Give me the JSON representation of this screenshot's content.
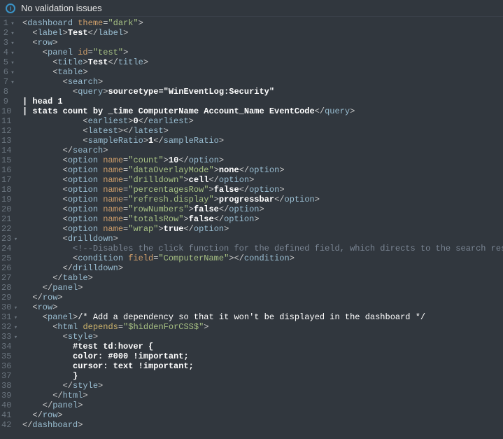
{
  "header": {
    "icon_label": "i",
    "title": "No validation issues"
  },
  "gutter": {
    "line_count": 42,
    "fold_lines": [
      1,
      2,
      3,
      4,
      5,
      6,
      7,
      23,
      30,
      31,
      32,
      33
    ]
  },
  "code": {
    "l1": {
      "pre": "<",
      "tag": "dashboard",
      "sp": " ",
      "attr": "theme",
      "eq": "=",
      "q1": "\"",
      "val": "dark",
      "q2": "\"",
      "suf": ">"
    },
    "l2": {
      "pre": "  <",
      "tag": "label",
      "suf": ">",
      "text": "Test",
      "cpre": "</",
      "ctag": "label",
      "csuf": ">"
    },
    "l3": {
      "pre": "  <",
      "tag": "row",
      "suf": ">"
    },
    "l4": {
      "pre": "    <",
      "tag": "panel",
      "sp": " ",
      "attr": "id",
      "eq": "=",
      "q1": "\"",
      "val": "test",
      "q2": "\"",
      "suf": ">"
    },
    "l5": {
      "pre": "      <",
      "tag": "title",
      "suf": ">",
      "text": "Test",
      "cpre": "</",
      "ctag": "title",
      "csuf": ">"
    },
    "l6": {
      "pre": "      <",
      "tag": "table",
      "suf": ">"
    },
    "l7": {
      "pre": "        <",
      "tag": "search",
      "suf": ">"
    },
    "l8": {
      "pre": "          <",
      "tag": "query",
      "suf": ">",
      "text": "sourcetype=\"WinEventLog:Security\""
    },
    "l9": {
      "text": "| head 1"
    },
    "l10": {
      "text": "| stats count by _time ComputerName Account_Name EventCode",
      "cpre": "</",
      "ctag": "query",
      "csuf": ">"
    },
    "l11": {
      "pre": "            <",
      "tag": "earliest",
      "suf": ">",
      "text": "0",
      "cpre": "</",
      "ctag": "earliest",
      "csuf": ">"
    },
    "l12": {
      "pre": "            <",
      "tag": "latest",
      "suf": ">",
      "cpre": "</",
      "ctag": "latest",
      "csuf": ">"
    },
    "l13": {
      "pre": "            <",
      "tag": "sampleRatio",
      "suf": ">",
      "text": "1",
      "cpre": "</",
      "ctag": "sampleRatio",
      "csuf": ">"
    },
    "l14": {
      "pre": "        </",
      "tag": "search",
      "suf": ">"
    },
    "l15": {
      "pre": "        <",
      "tag": "option",
      "sp": " ",
      "attr": "name",
      "eq": "=",
      "q1": "\"",
      "val": "count",
      "q2": "\"",
      "suf": ">",
      "text": "10",
      "cpre": "</",
      "ctag": "option",
      "csuf": ">"
    },
    "l16": {
      "pre": "        <",
      "tag": "option",
      "sp": " ",
      "attr": "name",
      "eq": "=",
      "q1": "\"",
      "val": "dataOverlayMode",
      "q2": "\"",
      "suf": ">",
      "text": "none",
      "cpre": "</",
      "ctag": "option",
      "csuf": ">"
    },
    "l17": {
      "pre": "        <",
      "tag": "option",
      "sp": " ",
      "attr": "name",
      "eq": "=",
      "q1": "\"",
      "val": "drilldown",
      "q2": "\"",
      "suf": ">",
      "text": "cell",
      "cpre": "</",
      "ctag": "option",
      "csuf": ">"
    },
    "l18": {
      "pre": "        <",
      "tag": "option",
      "sp": " ",
      "attr": "name",
      "eq": "=",
      "q1": "\"",
      "val": "percentagesRow",
      "q2": "\"",
      "suf": ">",
      "text": "false",
      "cpre": "</",
      "ctag": "option",
      "csuf": ">"
    },
    "l19": {
      "pre": "        <",
      "tag": "option",
      "sp": " ",
      "attr": "name",
      "eq": "=",
      "q1": "\"",
      "val": "refresh.display",
      "q2": "\"",
      "suf": ">",
      "text": "progressbar",
      "cpre": "</",
      "ctag": "option",
      "csuf": ">"
    },
    "l20": {
      "pre": "        <",
      "tag": "option",
      "sp": " ",
      "attr": "name",
      "eq": "=",
      "q1": "\"",
      "val": "rowNumbers",
      "q2": "\"",
      "suf": ">",
      "text": "false",
      "cpre": "</",
      "ctag": "option",
      "csuf": ">"
    },
    "l21": {
      "pre": "        <",
      "tag": "option",
      "sp": " ",
      "attr": "name",
      "eq": "=",
      "q1": "\"",
      "val": "totalsRow",
      "q2": "\"",
      "suf": ">",
      "text": "false",
      "cpre": "</",
      "ctag": "option",
      "csuf": ">"
    },
    "l22": {
      "pre": "        <",
      "tag": "option",
      "sp": " ",
      "attr": "name",
      "eq": "=",
      "q1": "\"",
      "val": "wrap",
      "q2": "\"",
      "suf": ">",
      "text": "true",
      "cpre": "</",
      "ctag": "option",
      "csuf": ">"
    },
    "l23": {
      "pre": "        <",
      "tag": "drilldown",
      "suf": ">"
    },
    "l24": {
      "comment": "          <!--Disables the click function for the defined field, which directs to the search results-->"
    },
    "l25": {
      "pre": "          <",
      "tag": "condition",
      "sp": " ",
      "attr": "field",
      "eq": "=",
      "q1": "\"",
      "val": "ComputerName",
      "q2": "\"",
      "suf": ">",
      "cpre": "</",
      "ctag": "condition",
      "csuf": ">"
    },
    "l26": {
      "pre": "        </",
      "tag": "drilldown",
      "suf": ">"
    },
    "l27": {
      "pre": "      </",
      "tag": "table",
      "suf": ">"
    },
    "l28": {
      "pre": "    </",
      "tag": "panel",
      "suf": ">"
    },
    "l29": {
      "pre": "  </",
      "tag": "row",
      "suf": ">"
    },
    "l30": {
      "pre": "  <",
      "tag": "row",
      "suf": ">"
    },
    "l31": {
      "pre": "    <",
      "tag": "panel",
      "suf": ">",
      "cmt": "/* Add a dependency so that it won't be displayed in the dashboard */"
    },
    "l32": {
      "pre": "      <",
      "tag": "html",
      "sp": " ",
      "attr": "depends",
      "eq": "=",
      "q1": "\"",
      "val": "$hiddenForCSS$",
      "q2": "\"",
      "suf": ">"
    },
    "l33": {
      "pre": "        <",
      "tag": "style",
      "suf": ">"
    },
    "l34": {
      "css": "          #test td:hover {"
    },
    "l35": {
      "css": "          color: #000 !important;"
    },
    "l36": {
      "css": "          cursor: text !important;"
    },
    "l37": {
      "css": "          }"
    },
    "l38": {
      "pre": "        </",
      "tag": "style",
      "suf": ">"
    },
    "l39": {
      "pre": "      </",
      "tag": "html",
      "suf": ">"
    },
    "l40": {
      "pre": "    </",
      "tag": "panel",
      "suf": ">"
    },
    "l41": {
      "pre": "  </",
      "tag": "row",
      "suf": ">"
    },
    "l42": {
      "pre": "</",
      "tag": "dashboard",
      "suf": ">"
    }
  }
}
